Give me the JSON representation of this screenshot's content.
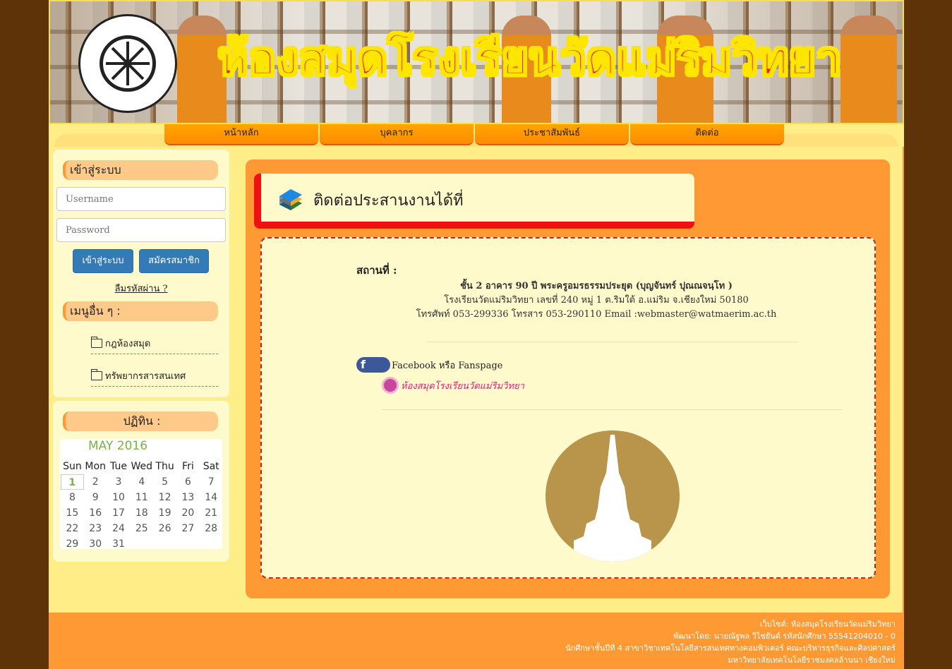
{
  "banner": {
    "title": "ห้องสมุดโรงเรียนวัดแม่ริมวิทยา"
  },
  "nav": {
    "items": [
      "หน้าหลัก",
      "บุคลากร",
      "ประชาสัมพันธ์",
      "ติดต่อ"
    ]
  },
  "login": {
    "heading": "เข้าสู่ระบบ",
    "username_placeholder": "Username",
    "password_placeholder": "Password",
    "login_button": "เข้าสู่ระบบ",
    "register_button": "สมัครสมาชิก",
    "forgot_link": "ลืมรหัสผ่าน ?"
  },
  "other_menu": {
    "heading": "เมนูอื่น ๆ :",
    "items": [
      "กฎห้องสมุด",
      "ทรัพยากรสารสนเทศ"
    ]
  },
  "calendar": {
    "heading": "ปฏิทิน :",
    "month_label": "MAY 2016",
    "weekdays": [
      "Sun",
      "Mon",
      "Tue",
      "Wed",
      "Thu",
      "Fri",
      "Sat"
    ],
    "days": [
      "1",
      "2",
      "3",
      "4",
      "5",
      "6",
      "7",
      "8",
      "9",
      "10",
      "11",
      "12",
      "13",
      "14",
      "15",
      "16",
      "17",
      "18",
      "19",
      "20",
      "21",
      "22",
      "23",
      "24",
      "25",
      "26",
      "27",
      "28",
      "29",
      "30",
      "31"
    ],
    "today": "1"
  },
  "main": {
    "title": "ติดต่อประสานงานได้ที่",
    "location_label": "สถานที่ :",
    "address_line1": "ชั้น 2 อาคาร 90 ปี พระครูอมรธรรมประยุต (บุญจันทร์ ปุณณจนฺโท )",
    "address_line2": "โรงเรียนวัดแม่ริมวิทยา เลขที่ 240 หมู่ 1 ต.ริมใต้ อ.แม่ริม จ.เชียงใหม่ 50180",
    "address_line3": "โทรศัพท์ 053-299336 โทรสาร 053-290110 Email :webmaster@watmaerim.ac.th",
    "facebook_text": "Facebook หรือ Fanspage",
    "fanpage_text": "ห้องสมุดโรงเรียนวัดแม่ริมวิทยา"
  },
  "footer": {
    "line1": "เว็บไซต์: ห้องสมุดโรงเรียนวัดแม่ริมวิทยา",
    "line2": "พัฒนาโดย: นายณัฐพล วิไชยันต์ รหัสนักศึกษา 55541204010 - 0",
    "line3": "นักศึกษาชั้นปีที่ 4 สาขาวิชาเทคโนโลยีสารสนเทศทางคอมพิวเตอร์ คณะบริหารธุรกิจและศิลปศาสตร์",
    "line4": "มหาวิทยาลัยเทคโนโลยีราชมงคลล้านนา เชียงใหม่"
  },
  "colors": {
    "page_bg": "#5e3308",
    "orange": "#ff9933",
    "cream": "#fffacc",
    "yellow": "#ffee88",
    "red": "#ee1111",
    "button_blue": "#337ab7"
  }
}
